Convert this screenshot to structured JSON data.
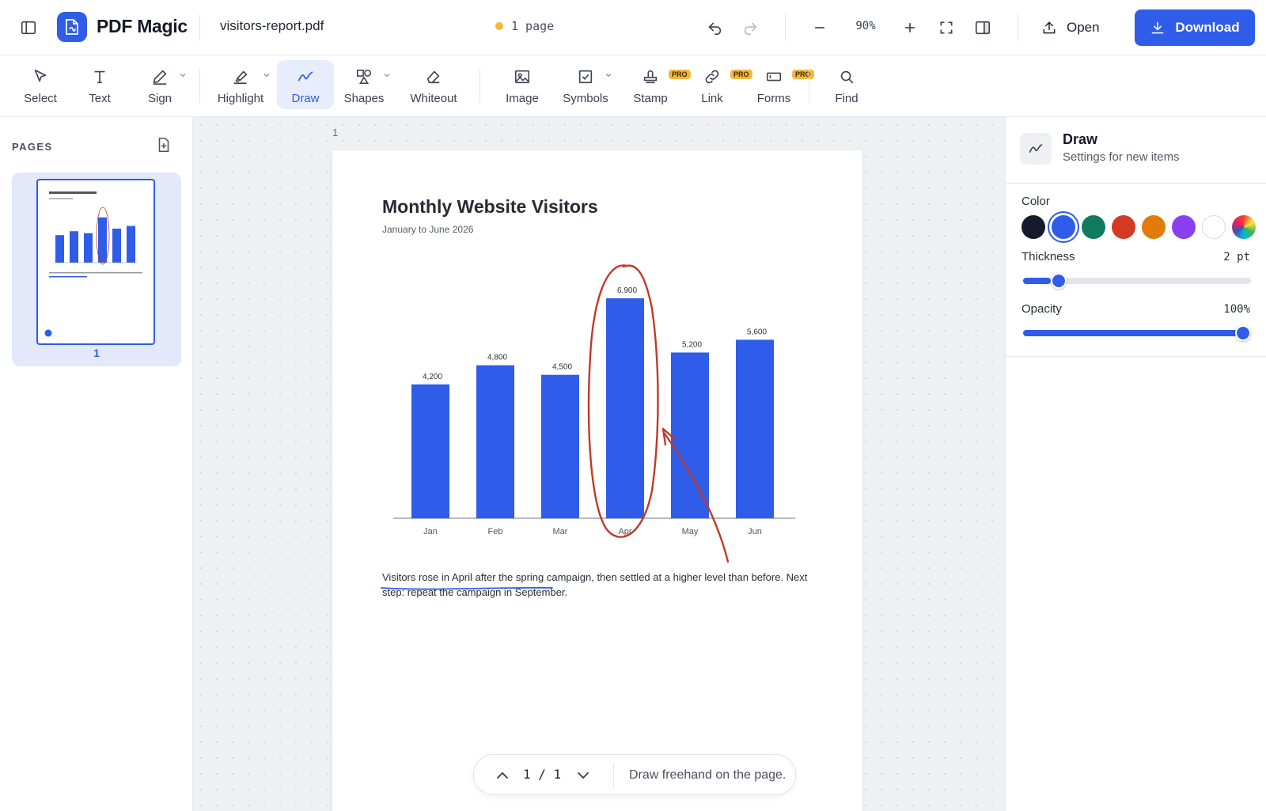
{
  "app": {
    "name": "PDF Magic",
    "filename": "visitors-report.pdf",
    "page_status": "1 page"
  },
  "header": {
    "zoom": "90%",
    "open_label": "Open",
    "download_label": "Download"
  },
  "tools": [
    {
      "label": "Select"
    },
    {
      "label": "Text"
    },
    {
      "label": "Sign"
    },
    {
      "label": "Highlight"
    },
    {
      "label": "Draw"
    },
    {
      "label": "Shapes"
    },
    {
      "label": "Whiteout"
    },
    {
      "label": "Image"
    },
    {
      "label": "Symbols"
    },
    {
      "label": "Stamp",
      "badge": "PRO"
    },
    {
      "label": "Link",
      "badge": "PRO"
    },
    {
      "label": "Forms",
      "badge": "PRO"
    },
    {
      "label": "Find"
    }
  ],
  "active_tool": "Draw",
  "sidebar": {
    "title": "PAGES",
    "pages": [
      {
        "number": "1"
      }
    ]
  },
  "canvas": {
    "page_index": "1"
  },
  "document": {
    "text_line1": "Visitors rose in April after the spring campaign, then settled at a higher level than before. Next",
    "text_line2_underlined": "step: repeat the campaign in September",
    "text_line2_tail": "."
  },
  "chart_data": {
    "type": "bar",
    "title": "Monthly Website Visitors",
    "subtitle": "January to June 2026",
    "categories": [
      "Jan",
      "Feb",
      "Mar",
      "Apr",
      "May",
      "Jun"
    ],
    "values": [
      4200,
      4800,
      4500,
      6900,
      5200,
      5600
    ],
    "data_labels": [
      "4,200",
      "4,800",
      "4,500",
      "6,900",
      "5,200",
      "5,600"
    ],
    "ylim": [
      0,
      7000
    ],
    "bar_color": "#2f5ce8",
    "grid": false,
    "annotations": [
      "red ellipse around Apr bar",
      "red arrow pointing to Apr bar",
      "blue underline under closing sentence"
    ]
  },
  "pager": {
    "current": "1",
    "total": "1",
    "hint": "Draw freehand on the page."
  },
  "settings": {
    "title": "Draw",
    "subtitle": "Settings for new items",
    "color_label": "Color",
    "colors": [
      "#151a2d",
      "#2f5ce8",
      "#0f7a5c",
      "#d23a22",
      "#e07b0c",
      "#8a3ff0",
      "#ffffff",
      "rainbow"
    ],
    "selected_color": "#2f5ce8",
    "thickness_label": "Thickness",
    "thickness_value": "2 pt",
    "thickness_fraction": 0.12,
    "opacity_label": "Opacity",
    "opacity_value": "100%",
    "opacity_fraction": 1.0
  }
}
